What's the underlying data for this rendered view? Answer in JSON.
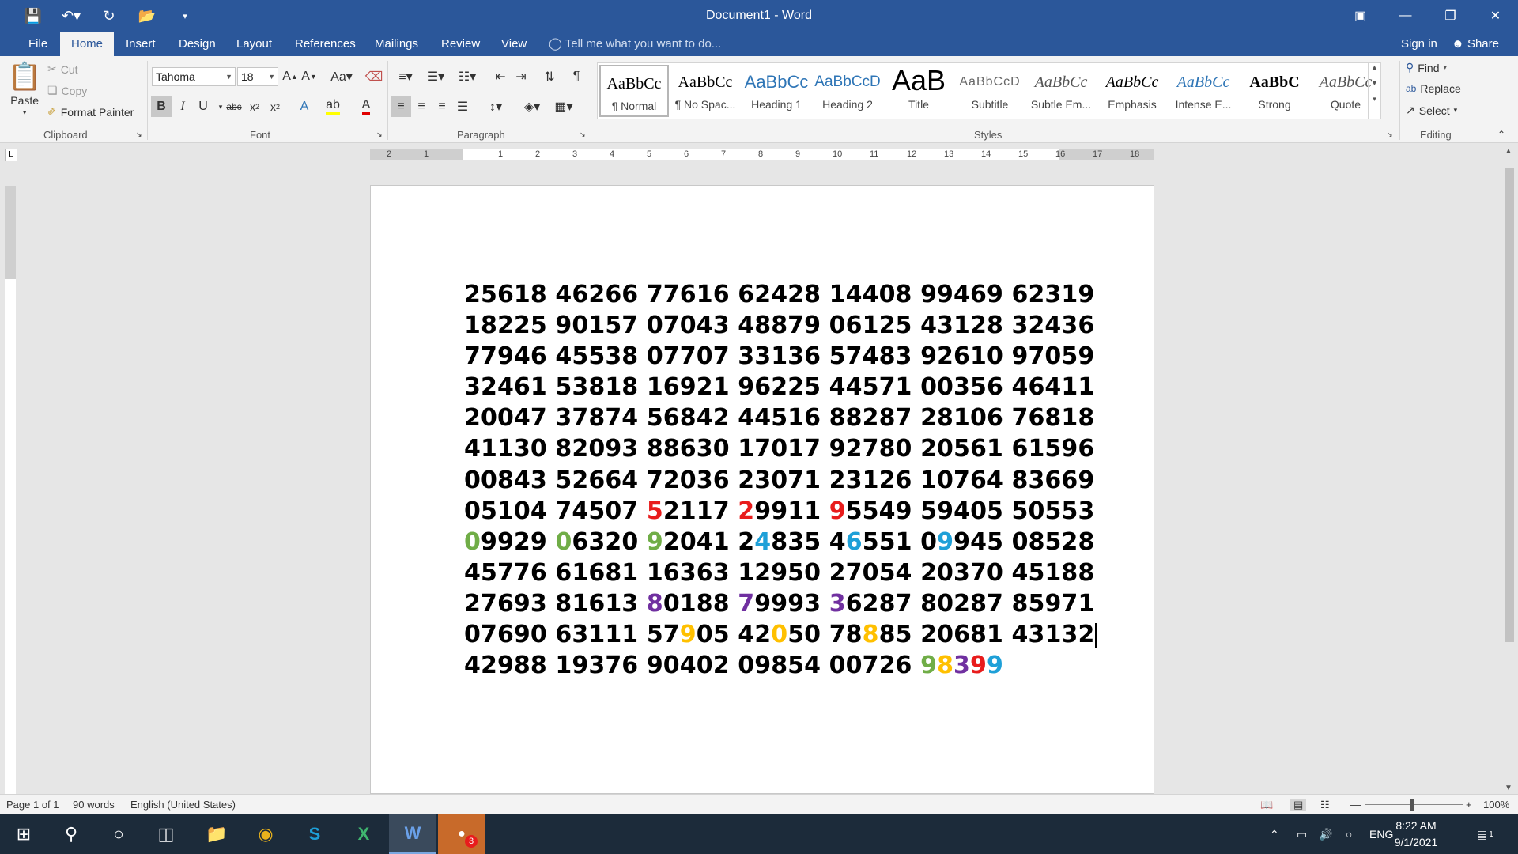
{
  "window": {
    "title": "Document1 - Word"
  },
  "tabs": [
    "File",
    "Home",
    "Insert",
    "Design",
    "Layout",
    "References",
    "Mailings",
    "Review",
    "View"
  ],
  "active_tab": "Home",
  "tell_me": "Tell me what you want to do...",
  "account": {
    "sign_in": "Sign in",
    "share": "Share"
  },
  "clipboard": {
    "paste": "Paste",
    "cut": "Cut",
    "copy": "Copy",
    "format_painter": "Format Painter",
    "label": "Clipboard"
  },
  "font": {
    "name": "Tahoma",
    "size": "18",
    "label": "Font"
  },
  "paragraph": {
    "label": "Paragraph"
  },
  "styles": {
    "label": "Styles",
    "items": [
      {
        "preview": "AaBbCc",
        "name": "¶ Normal"
      },
      {
        "preview": "AaBbCc",
        "name": "¶ No Spac..."
      },
      {
        "preview": "AaBbCc",
        "name": "Heading 1"
      },
      {
        "preview": "AaBbCcD",
        "name": "Heading 2"
      },
      {
        "preview": "AaB",
        "name": "Title"
      },
      {
        "preview": "AaBbCcD",
        "name": "Subtitle"
      },
      {
        "preview": "AaBbCc",
        "name": "Subtle Em..."
      },
      {
        "preview": "AaBbCc",
        "name": "Emphasis"
      },
      {
        "preview": "AaBbCc",
        "name": "Intense E..."
      },
      {
        "preview": "AaBbC",
        "name": "Strong"
      },
      {
        "preview": "AaBbCc",
        "name": "Quote"
      }
    ]
  },
  "editing": {
    "find": "Find",
    "replace": "Replace",
    "select": "Select",
    "label": "Editing"
  },
  "colors": {
    "red": "#e81c1c",
    "green": "#70ad47",
    "blue": "#1ea0d8",
    "purple": "#7030a0",
    "gold": "#ffc000",
    "black": "#000000"
  },
  "document_lines": [
    [
      [
        "25618 46266 77616 62428 14408 99469 62319",
        "black"
      ]
    ],
    [
      [
        "18225 90157 07043 48879 06125 43128 32436",
        "black"
      ]
    ],
    [
      [
        "77946 45538 07707 33136 57483 92610 97059",
        "black"
      ]
    ],
    [
      [
        "32461 53818 16921 96225 44571 00356 46411",
        "black"
      ]
    ],
    [
      [
        "20047 37874 56842 44516 88287 28106 76818",
        "black"
      ]
    ],
    [
      [
        "41130 82093 88630 17017 92780 20561 61596",
        "black"
      ]
    ],
    [
      [
        "00843 52664 72036 23071 23126 10764 83669",
        "black"
      ]
    ],
    [
      [
        "05104 74507 ",
        "black"
      ],
      [
        "5",
        "red"
      ],
      [
        "2117 ",
        "black"
      ],
      [
        "2",
        "red"
      ],
      [
        "9911 ",
        "black"
      ],
      [
        "9",
        "red"
      ],
      [
        "5549 59405 50553",
        "black"
      ]
    ],
    [
      [
        "0",
        "green"
      ],
      [
        "9929 ",
        "black"
      ],
      [
        "0",
        "green"
      ],
      [
        "6320 ",
        "black"
      ],
      [
        "9",
        "green"
      ],
      [
        "2041 2",
        "black"
      ],
      [
        "4",
        "blue"
      ],
      [
        "835 4",
        "black"
      ],
      [
        "6",
        "blue"
      ],
      [
        "551 0",
        "black"
      ],
      [
        "9",
        "blue"
      ],
      [
        "945 08528",
        "black"
      ]
    ],
    [
      [
        "45776 61681 16363 12950 27054 20370 45188",
        "black"
      ]
    ],
    [
      [
        "27693 81613 ",
        "black"
      ],
      [
        "8",
        "purple"
      ],
      [
        "0188 ",
        "black"
      ],
      [
        "7",
        "purple"
      ],
      [
        "9993 ",
        "black"
      ],
      [
        "3",
        "purple"
      ],
      [
        "6287 80287 85971",
        "black"
      ]
    ],
    [
      [
        "07690 63111 57",
        "black"
      ],
      [
        "9",
        "gold"
      ],
      [
        "05 42",
        "black"
      ],
      [
        "0",
        "gold"
      ],
      [
        "50 78",
        "black"
      ],
      [
        "8",
        "gold"
      ],
      [
        "85 20681 43132",
        "black"
      ]
    ],
    [
      [
        "42988 19376 90402 09854 00726 ",
        "black"
      ],
      [
        "9",
        "green"
      ],
      [
        "8",
        "gold"
      ],
      [
        "3",
        "purple"
      ],
      [
        "9",
        "red"
      ],
      [
        "9",
        "blue"
      ]
    ]
  ],
  "status": {
    "page": "Page 1 of 1",
    "words": "90 words",
    "language": "English (United States)",
    "zoom": "100%"
  },
  "tray": {
    "lang": "ENG",
    "time": "8:22 AM",
    "date": "9/1/2021",
    "notifications": "1",
    "zalo_badge": "3"
  }
}
